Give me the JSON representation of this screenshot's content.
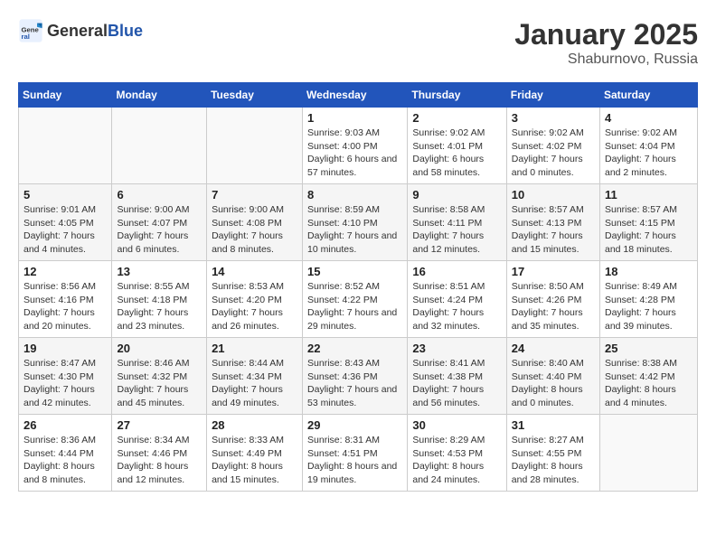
{
  "logo": {
    "text_general": "General",
    "text_blue": "Blue"
  },
  "title": "January 2025",
  "subtitle": "Shaburnovo, Russia",
  "weekdays": [
    "Sunday",
    "Monday",
    "Tuesday",
    "Wednesday",
    "Thursday",
    "Friday",
    "Saturday"
  ],
  "weeks": [
    [
      {
        "day": "",
        "info": ""
      },
      {
        "day": "",
        "info": ""
      },
      {
        "day": "",
        "info": ""
      },
      {
        "day": "1",
        "info": "Sunrise: 9:03 AM\nSunset: 4:00 PM\nDaylight: 6 hours and 57 minutes."
      },
      {
        "day": "2",
        "info": "Sunrise: 9:02 AM\nSunset: 4:01 PM\nDaylight: 6 hours and 58 minutes."
      },
      {
        "day": "3",
        "info": "Sunrise: 9:02 AM\nSunset: 4:02 PM\nDaylight: 7 hours and 0 minutes."
      },
      {
        "day": "4",
        "info": "Sunrise: 9:02 AM\nSunset: 4:04 PM\nDaylight: 7 hours and 2 minutes."
      }
    ],
    [
      {
        "day": "5",
        "info": "Sunrise: 9:01 AM\nSunset: 4:05 PM\nDaylight: 7 hours and 4 minutes."
      },
      {
        "day": "6",
        "info": "Sunrise: 9:00 AM\nSunset: 4:07 PM\nDaylight: 7 hours and 6 minutes."
      },
      {
        "day": "7",
        "info": "Sunrise: 9:00 AM\nSunset: 4:08 PM\nDaylight: 7 hours and 8 minutes."
      },
      {
        "day": "8",
        "info": "Sunrise: 8:59 AM\nSunset: 4:10 PM\nDaylight: 7 hours and 10 minutes."
      },
      {
        "day": "9",
        "info": "Sunrise: 8:58 AM\nSunset: 4:11 PM\nDaylight: 7 hours and 12 minutes."
      },
      {
        "day": "10",
        "info": "Sunrise: 8:57 AM\nSunset: 4:13 PM\nDaylight: 7 hours and 15 minutes."
      },
      {
        "day": "11",
        "info": "Sunrise: 8:57 AM\nSunset: 4:15 PM\nDaylight: 7 hours and 18 minutes."
      }
    ],
    [
      {
        "day": "12",
        "info": "Sunrise: 8:56 AM\nSunset: 4:16 PM\nDaylight: 7 hours and 20 minutes."
      },
      {
        "day": "13",
        "info": "Sunrise: 8:55 AM\nSunset: 4:18 PM\nDaylight: 7 hours and 23 minutes."
      },
      {
        "day": "14",
        "info": "Sunrise: 8:53 AM\nSunset: 4:20 PM\nDaylight: 7 hours and 26 minutes."
      },
      {
        "day": "15",
        "info": "Sunrise: 8:52 AM\nSunset: 4:22 PM\nDaylight: 7 hours and 29 minutes."
      },
      {
        "day": "16",
        "info": "Sunrise: 8:51 AM\nSunset: 4:24 PM\nDaylight: 7 hours and 32 minutes."
      },
      {
        "day": "17",
        "info": "Sunrise: 8:50 AM\nSunset: 4:26 PM\nDaylight: 7 hours and 35 minutes."
      },
      {
        "day": "18",
        "info": "Sunrise: 8:49 AM\nSunset: 4:28 PM\nDaylight: 7 hours and 39 minutes."
      }
    ],
    [
      {
        "day": "19",
        "info": "Sunrise: 8:47 AM\nSunset: 4:30 PM\nDaylight: 7 hours and 42 minutes."
      },
      {
        "day": "20",
        "info": "Sunrise: 8:46 AM\nSunset: 4:32 PM\nDaylight: 7 hours and 45 minutes."
      },
      {
        "day": "21",
        "info": "Sunrise: 8:44 AM\nSunset: 4:34 PM\nDaylight: 7 hours and 49 minutes."
      },
      {
        "day": "22",
        "info": "Sunrise: 8:43 AM\nSunset: 4:36 PM\nDaylight: 7 hours and 53 minutes."
      },
      {
        "day": "23",
        "info": "Sunrise: 8:41 AM\nSunset: 4:38 PM\nDaylight: 7 hours and 56 minutes."
      },
      {
        "day": "24",
        "info": "Sunrise: 8:40 AM\nSunset: 4:40 PM\nDaylight: 8 hours and 0 minutes."
      },
      {
        "day": "25",
        "info": "Sunrise: 8:38 AM\nSunset: 4:42 PM\nDaylight: 8 hours and 4 minutes."
      }
    ],
    [
      {
        "day": "26",
        "info": "Sunrise: 8:36 AM\nSunset: 4:44 PM\nDaylight: 8 hours and 8 minutes."
      },
      {
        "day": "27",
        "info": "Sunrise: 8:34 AM\nSunset: 4:46 PM\nDaylight: 8 hours and 12 minutes."
      },
      {
        "day": "28",
        "info": "Sunrise: 8:33 AM\nSunset: 4:49 PM\nDaylight: 8 hours and 15 minutes."
      },
      {
        "day": "29",
        "info": "Sunrise: 8:31 AM\nSunset: 4:51 PM\nDaylight: 8 hours and 19 minutes."
      },
      {
        "day": "30",
        "info": "Sunrise: 8:29 AM\nSunset: 4:53 PM\nDaylight: 8 hours and 24 minutes."
      },
      {
        "day": "31",
        "info": "Sunrise: 8:27 AM\nSunset: 4:55 PM\nDaylight: 8 hours and 28 minutes."
      },
      {
        "day": "",
        "info": ""
      }
    ]
  ]
}
